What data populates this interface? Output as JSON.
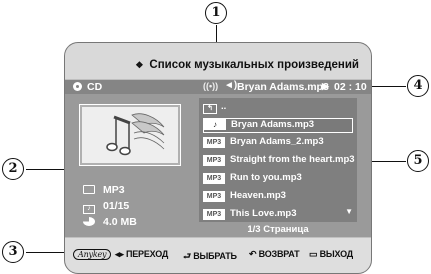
{
  "screen": {
    "title": "Список музыкальных произведений",
    "status": {
      "disc": "CD",
      "mode_icon": "((•))",
      "speaker_icon": "◄)",
      "track": "Bryan Adams.mp3",
      "play_icon": "▶",
      "time": "02 : 10"
    },
    "info": {
      "type": "MP3",
      "count": "01/15",
      "size": "4.0 MB"
    },
    "list": {
      "up_label": "..",
      "items": [
        {
          "badge": "♪",
          "name": "Bryan Adams.mp3"
        },
        {
          "badge": "MP3",
          "name": "Bryan Adams_2.mp3"
        },
        {
          "badge": "MP3",
          "name": "Straight from the heart.mp3"
        },
        {
          "badge": "MP3",
          "name": "Run to you.mp3"
        },
        {
          "badge": "MP3",
          "name": "Heaven.mp3"
        },
        {
          "badge": "MP3",
          "name": "This Love.mp3"
        }
      ],
      "page": "1/3 Страница"
    },
    "bottom": {
      "anykey": "Anykey",
      "move_icon": "◂▸",
      "move": "ПЕРЕХОД",
      "select_icon": "⮐",
      "select": "ВЫБРАТЬ",
      "return_icon": "↶",
      "return": "ВОЗВРАТ",
      "exit_icon": "▭",
      "exit": "ВЫХОД"
    }
  },
  "callouts": [
    "1",
    "2",
    "3",
    "4",
    "5"
  ]
}
